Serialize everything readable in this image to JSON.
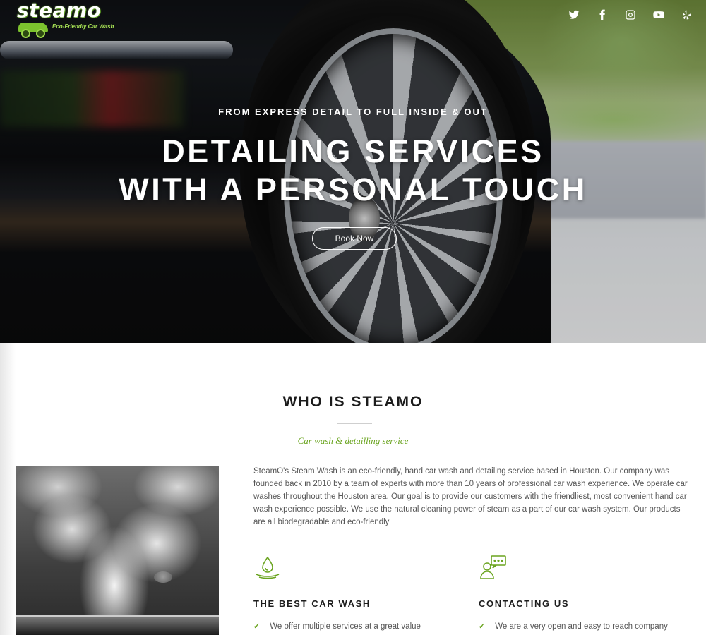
{
  "brand": {
    "name": "steamo",
    "tagline": "Eco-Friendly Car Wash",
    "accent_color": "#6aa41f"
  },
  "social": [
    {
      "name": "twitter",
      "icon": "twitter-icon"
    },
    {
      "name": "facebook",
      "icon": "facebook-icon"
    },
    {
      "name": "instagram",
      "icon": "instagram-icon"
    },
    {
      "name": "youtube",
      "icon": "youtube-icon"
    },
    {
      "name": "yelp",
      "icon": "yelp-icon"
    }
  ],
  "hero": {
    "subtitle": "FROM EXPRESS DETAIL TO FULL INSIDE & OUT",
    "title_line1": "DETAILING SERVICES",
    "title_line2": "WITH A PERSONAL TOUCH",
    "cta_label": "Book Now"
  },
  "about": {
    "title": "WHO IS STEAMO",
    "tagline": "Car wash & detailling service",
    "body": "SteamO's Steam Wash is an eco-friendly, hand car wash and detailing service based in Houston. Our company was founded back in 2010 by a team of experts with more than 10 years of professional car wash experience. We operate car washes throughout the Houston area. Our goal is to provide our customers with the friendliest, most convenient hand car wash experience possible. We use the natural cleaning power of steam as a part of our car wash system. Our products are all biodegradable and eco-friendly",
    "features": [
      {
        "icon": "water-drop-icon",
        "title": "THE BEST CAR WASH",
        "item": "We offer multiple services at a great value"
      },
      {
        "icon": "chat-user-icon",
        "title": "CONTACTING US",
        "item": "We are a very open and easy to reach company"
      }
    ]
  }
}
